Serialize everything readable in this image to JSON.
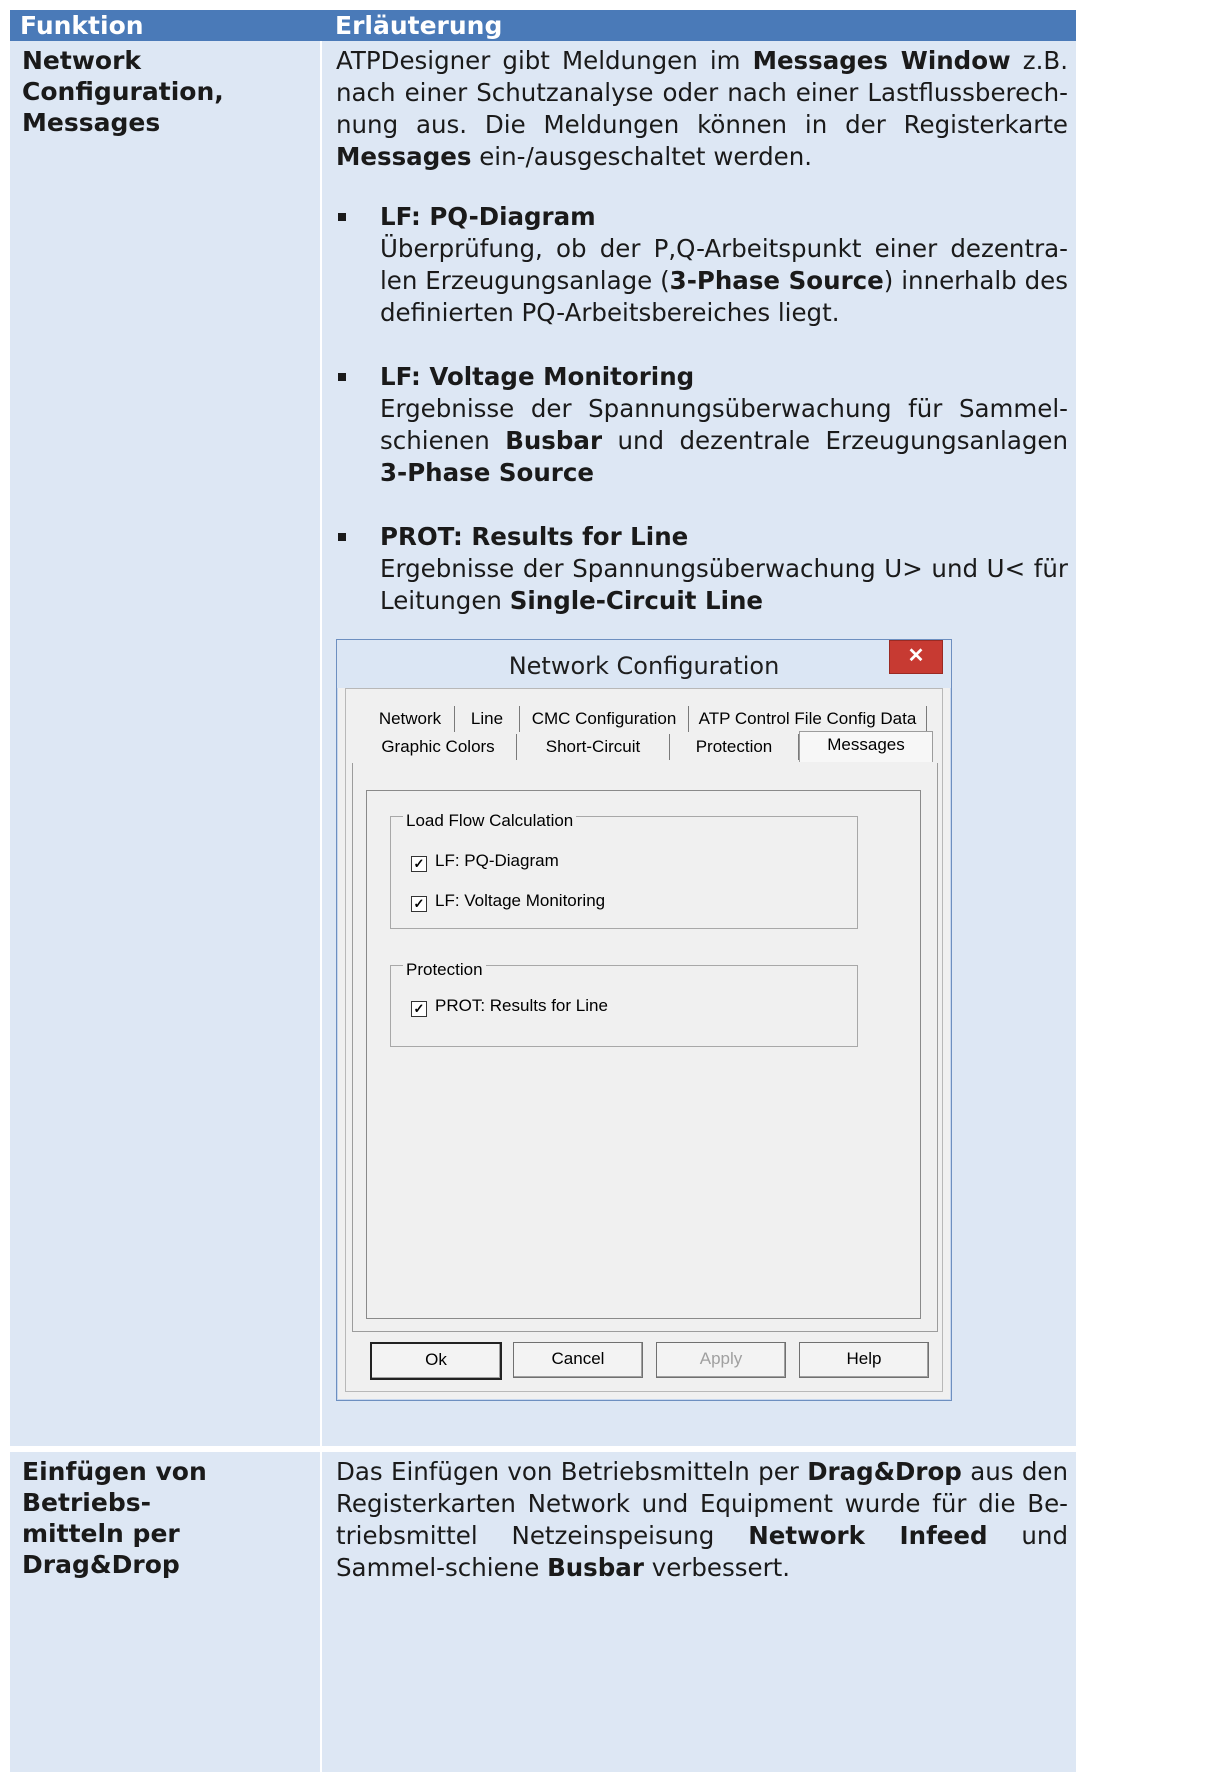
{
  "table": {
    "headers": {
      "funktion": "Funktion",
      "erlaeuterung": "Erläuterung"
    },
    "row1": {
      "left_line1": "Network Configuration,",
      "left_line2": "Messages",
      "intro": [
        {
          "t": "ATPDesigner gibt Meldungen im ",
          "b": false
        },
        {
          "t": "Messages Window",
          "b": true
        },
        {
          "t": " z.B. nach einer Schutzanalyse oder nach einer Lastflussberech-nung aus. Die Meldungen können in der Registerkarte ",
          "b": false
        },
        {
          "t": "Messages",
          "b": true
        },
        {
          "t": " ein-/ausgeschaltet werden.",
          "b": false
        }
      ],
      "bullets": [
        {
          "title": "LF: PQ-Diagram",
          "body": [
            {
              "t": "Überprüfung, ob der P,Q-Arbeitspunkt einer dezentra-len Erzeugungsanlage (",
              "b": false
            },
            {
              "t": "3-Phase Source",
              "b": true
            },
            {
              "t": ") innerhalb des definierten PQ-Arbeitsbereiches liegt.",
              "b": false
            }
          ]
        },
        {
          "title": "LF: Voltage Monitoring",
          "body": [
            {
              "t": "Ergebnisse der Spannungsüberwachung für Sammel-schienen ",
              "b": false
            },
            {
              "t": "Busbar",
              "b": true
            },
            {
              "t": " und dezentrale Erzeugungsanlagen ",
              "b": false
            },
            {
              "t": "3-Phase Source",
              "b": true
            }
          ]
        },
        {
          "title": "PROT: Results for Line",
          "body": [
            {
              "t": "Ergebnisse der Spannungsüberwachung U> und U< für Leitungen ",
              "b": false
            },
            {
              "t": "Single-Circuit Line",
              "b": true
            }
          ]
        }
      ]
    },
    "row2": {
      "left_line1": "Einfügen von Betriebs-",
      "left_line2": "mitteln per Drag&Drop",
      "text": [
        {
          "t": "Das Einfügen von Betriebsmitteln per ",
          "b": false
        },
        {
          "t": "Drag&Drop",
          "b": true
        },
        {
          "t": " aus den Registerkarten Network und Equipment wurde für die Be-triebsmittel Netzeinspeisung ",
          "b": false
        },
        {
          "t": "Network Infeed",
          "b": true
        },
        {
          "t": " und Sammel-schiene ",
          "b": false
        },
        {
          "t": "Busbar",
          "b": true
        },
        {
          "t": " verbessert.",
          "b": false
        }
      ]
    }
  },
  "dialog": {
    "title": "Network Configuration",
    "close_glyph": "✕",
    "tabs_row1": [
      "Network",
      "Line",
      "CMC Configuration",
      "ATP Control File Config Data"
    ],
    "tabs_row2": [
      "Graphic Colors",
      "Short-Circuit",
      "Protection",
      "Messages"
    ],
    "active_tab": "Messages",
    "group1": {
      "title": "Load Flow Calculation",
      "items": [
        {
          "label": "LF: PQ-Diagram",
          "checked": true
        },
        {
          "label": "LF: Voltage Monitoring",
          "checked": true
        }
      ]
    },
    "group2": {
      "title": "Protection",
      "items": [
        {
          "label": "PROT: Results for Line",
          "checked": true
        }
      ]
    },
    "buttons": {
      "ok": "Ok",
      "cancel": "Cancel",
      "apply": "Apply",
      "help": "Help"
    },
    "check_glyph": "✓"
  },
  "colors": {
    "header_bg": "#4a7ab8",
    "row_bg": "#dde7f4",
    "close_bg": "#c73a32"
  }
}
